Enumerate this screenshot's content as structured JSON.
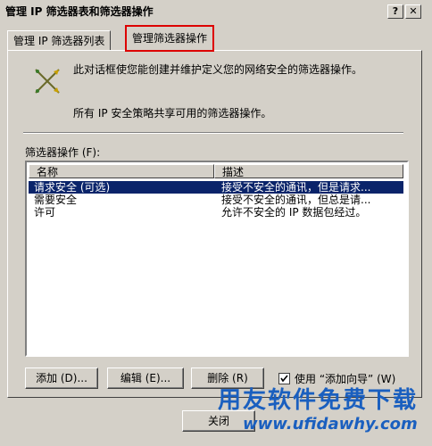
{
  "window": {
    "title": "管理 IP 筛选器表和筛选器操作",
    "help": "?",
    "close": "✕"
  },
  "tabs": [
    {
      "label": "管理 IP 筛选器列表"
    },
    {
      "label": "管理筛选器操作"
    }
  ],
  "description": {
    "line1": "此对话框使您能创建并维护定义您的网络安全的筛选器操作。",
    "line2": "所有 IP 安全策略共享可用的筛选器操作。"
  },
  "list": {
    "label": "筛选器操作 (F):",
    "columns": [
      "名称",
      "描述"
    ],
    "rows": [
      {
        "name": "请求安全 (可选)",
        "desc": "接受不安全的通讯，但是请求...",
        "selected": true
      },
      {
        "name": "需要安全",
        "desc": "接受不安全的通讯，但总是请...",
        "selected": false
      },
      {
        "name": "许可",
        "desc": "允许不安全的 IP 数据包经过。",
        "selected": false
      }
    ]
  },
  "buttons": {
    "add": "添加 (D)...",
    "edit": "编辑 (E)...",
    "remove": "删除 (R)",
    "close": "关闭"
  },
  "wizard": {
    "label": "使用 “添加向导” (W)",
    "checked": true
  },
  "watermark": {
    "line1": "用友软件免费下载",
    "line2": "www.ufidawhy.com"
  }
}
